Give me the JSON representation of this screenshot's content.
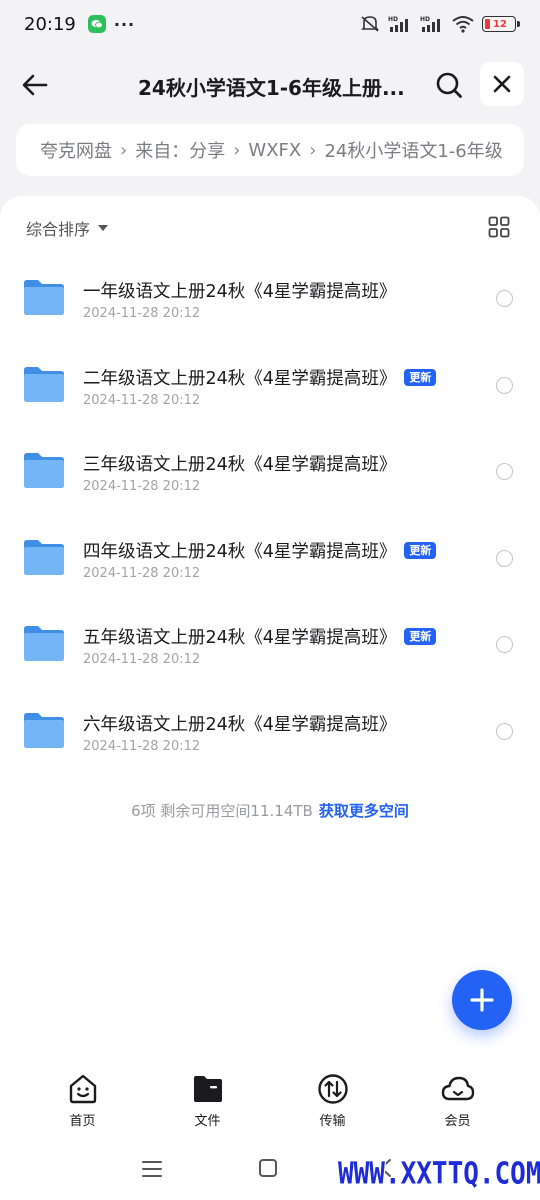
{
  "status_bar": {
    "time": "20:19",
    "more": "···",
    "battery": "12",
    "battery_color": "#e83b3b"
  },
  "header": {
    "title": "24秋小学语文1-6年级上册...",
    "back_icon": "arrow-left-icon",
    "search_icon": "search-icon",
    "close_icon": "close-icon"
  },
  "breadcrumb": {
    "items": [
      "夸克网盘",
      "来自：分享",
      "WXFX",
      "24秋小学语文1-6年级"
    ]
  },
  "toolbar": {
    "sort_label": "综合排序",
    "view_icon": "grid-view-icon"
  },
  "files": [
    {
      "name": "一年级语文上册24秋《4星学霸提高班》",
      "date": "2024-11-28 20:12",
      "badge": ""
    },
    {
      "name": "二年级语文上册24秋《4星学霸提高班》",
      "date": "2024-11-28 20:12",
      "badge": "更新"
    },
    {
      "name": "三年级语文上册24秋《4星学霸提高班》",
      "date": "2024-11-28 20:12",
      "badge": ""
    },
    {
      "name": "四年级语文上册24秋《4星学霸提高班》",
      "date": "2024-11-28 20:12",
      "badge": "更新"
    },
    {
      "name": "五年级语文上册24秋《4星学霸提高班》",
      "date": "2024-11-28 20:12",
      "badge": "更新"
    },
    {
      "name": "六年级语文上册24秋《4星学霸提高班》",
      "date": "2024-11-28 20:12",
      "badge": ""
    }
  ],
  "footer": {
    "storage_text": "6项 剩余可用空间11.14TB",
    "storage_link": "获取更多空间"
  },
  "bottom_nav": {
    "items": [
      {
        "label": "首页",
        "icon": "home-face-icon"
      },
      {
        "label": "文件",
        "icon": "folder-file-icon"
      },
      {
        "label": "传输",
        "icon": "transfer-icon"
      },
      {
        "label": "会员",
        "icon": "cloud-member-icon"
      }
    ]
  },
  "watermark": "WWW.XXTTQ.COM",
  "colors": {
    "accent": "#2462f5",
    "folder": "#5aa8f0",
    "background": "#f3f3f5"
  }
}
